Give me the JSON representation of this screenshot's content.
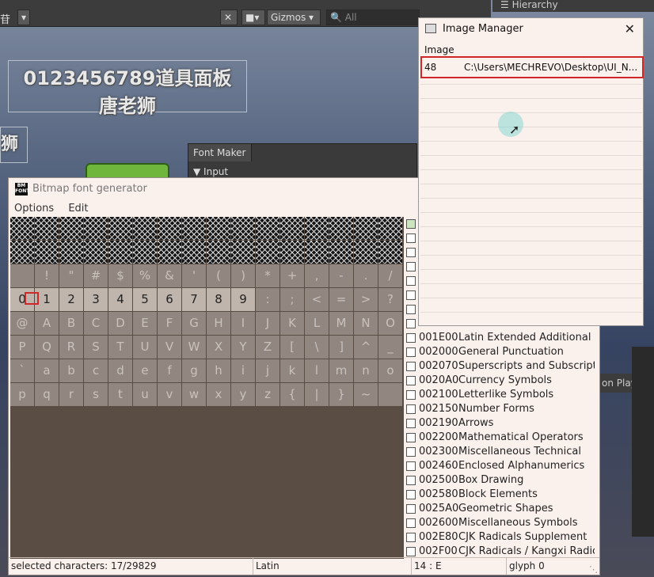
{
  "toolbar": {
    "left_fragment": "苷",
    "gizmos_label": "Gizmos",
    "search_placeholder": "All"
  },
  "hierarchy": {
    "tab_label": "Hierarchy"
  },
  "scene": {
    "line1": "0123456789道具面板",
    "line2": "唐老狮",
    "side_glyph": "狮",
    "play_fragment": "on Play"
  },
  "font_maker": {
    "tab_label": "Font Maker",
    "section_label": "Input"
  },
  "bitmap_window": {
    "title": "Bitmap font generator",
    "logo_text": "BM FONT",
    "menu": [
      "Options",
      "Edit"
    ],
    "grid_rows": [
      {
        "chars": [
          "",
          "",
          "",
          "",
          "",
          "",
          "",
          "",
          "",
          "",
          "",
          "",
          "",
          "",
          "",
          ""
        ],
        "style": "hatch"
      },
      {
        "chars": [
          "",
          "",
          "",
          "",
          "",
          "",
          "",
          "",
          "",
          "",
          "",
          "",
          "",
          "",
          "",
          ""
        ],
        "style": "hatch"
      },
      {
        "chars": [
          "",
          "!",
          "\"",
          "#",
          "$",
          "%",
          "&",
          "'",
          "(",
          ")",
          "*",
          "+",
          ",",
          "-",
          ".",
          "/"
        ],
        "style": "lite"
      },
      {
        "chars": [
          "0",
          "1",
          "2",
          "3",
          "4",
          "5",
          "6",
          "7",
          "8",
          "9",
          ":",
          ";",
          "<",
          "=",
          ">",
          "?"
        ],
        "style": "digits"
      },
      {
        "chars": [
          "@",
          "A",
          "B",
          "C",
          "D",
          "E",
          "F",
          "G",
          "H",
          "I",
          "J",
          "K",
          "L",
          "M",
          "N",
          "O"
        ],
        "style": "lite"
      },
      {
        "chars": [
          "P",
          "Q",
          "R",
          "S",
          "T",
          "U",
          "V",
          "W",
          "X",
          "Y",
          "Z",
          "[",
          "\\",
          "]",
          "^",
          "_"
        ],
        "style": "lite"
      },
      {
        "chars": [
          "`",
          "a",
          "b",
          "c",
          "d",
          "e",
          "f",
          "g",
          "h",
          "i",
          "j",
          "k",
          "l",
          "m",
          "n",
          "o"
        ],
        "style": "lite"
      },
      {
        "chars": [
          "p",
          "q",
          "r",
          "s",
          "t",
          "u",
          "v",
          "w",
          "x",
          "y",
          "z",
          "{",
          "|",
          "}",
          "~",
          ""
        ],
        "style": "lite"
      }
    ],
    "charsets": [
      {
        "code": "001E00",
        "name": "Latin Extended Additional"
      },
      {
        "code": "002000",
        "name": "General Punctuation"
      },
      {
        "code": "002070",
        "name": "Superscripts and Subscripts"
      },
      {
        "code": "0020A0",
        "name": "Currency Symbols"
      },
      {
        "code": "002100",
        "name": "Letterlike Symbols"
      },
      {
        "code": "002150",
        "name": "Number Forms"
      },
      {
        "code": "002190",
        "name": "Arrows"
      },
      {
        "code": "002200",
        "name": "Mathematical Operators"
      },
      {
        "code": "002300",
        "name": "Miscellaneous Technical"
      },
      {
        "code": "002460",
        "name": "Enclosed Alphanumerics"
      },
      {
        "code": "002500",
        "name": "Box Drawing"
      },
      {
        "code": "002580",
        "name": "Block Elements"
      },
      {
        "code": "0025A0",
        "name": "Geometric Shapes"
      },
      {
        "code": "002600",
        "name": "Miscellaneous Symbols"
      },
      {
        "code": "002E80",
        "name": "CJK Radicals Supplement"
      },
      {
        "code": "002F00",
        "name": "CJK Radicals / Kangxi Radica"
      }
    ],
    "status": {
      "selected": "selected characters: 17/29829",
      "charset": "Latin",
      "position": "14 : E",
      "glyph": "glyph 0"
    }
  },
  "image_manager": {
    "title": "Image Manager",
    "column_header": "Image",
    "rows": [
      {
        "id": "48",
        "path": "C:\\Users\\MECHREVO\\Desktop\\UI_N..."
      }
    ]
  },
  "colors": {
    "highlight_red": "#d02828",
    "window_bg": "#fbf1ec",
    "grid_bg": "#5a4d44"
  }
}
